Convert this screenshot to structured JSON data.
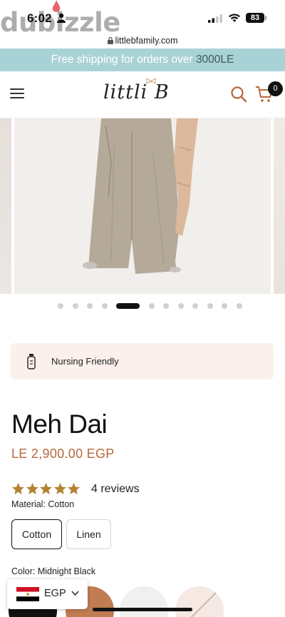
{
  "status_bar": {
    "time": "6:02",
    "battery": "83",
    "watermark": "dubizzle",
    "url": "littlebfamily.com"
  },
  "banner": {
    "text": "Free shipping for orders over ",
    "amount": "3000LE",
    "background": "#a9d2d6"
  },
  "header": {
    "logo": "littli B",
    "cart_count": "0"
  },
  "gallery": {
    "slide_count": 12,
    "active_slide": 5
  },
  "feature": {
    "label": "Nursing Friendly",
    "icon": "bottle-icon"
  },
  "product": {
    "title": "Meh Dai",
    "price": "LE 2,900.00 EGP",
    "price_color": "#b7683a",
    "rating": 5,
    "reviews": "4 reviews",
    "material_label": "Material: Cotton",
    "materials": [
      "Cotton",
      "Linen"
    ],
    "selected_material": "Cotton",
    "color_label": "Color: Midnight Black",
    "colors": [
      {
        "name": "Midnight Black",
        "hex": "#111111"
      },
      {
        "name": "Camel",
        "hex": "#c07c52"
      },
      {
        "name": "Light Grey",
        "hex": "#f0f0f0"
      },
      {
        "name": "Blush",
        "hex": "#f6e9e3"
      }
    ]
  },
  "currency": {
    "code": "EGP",
    "flag": "egypt-flag-icon"
  }
}
